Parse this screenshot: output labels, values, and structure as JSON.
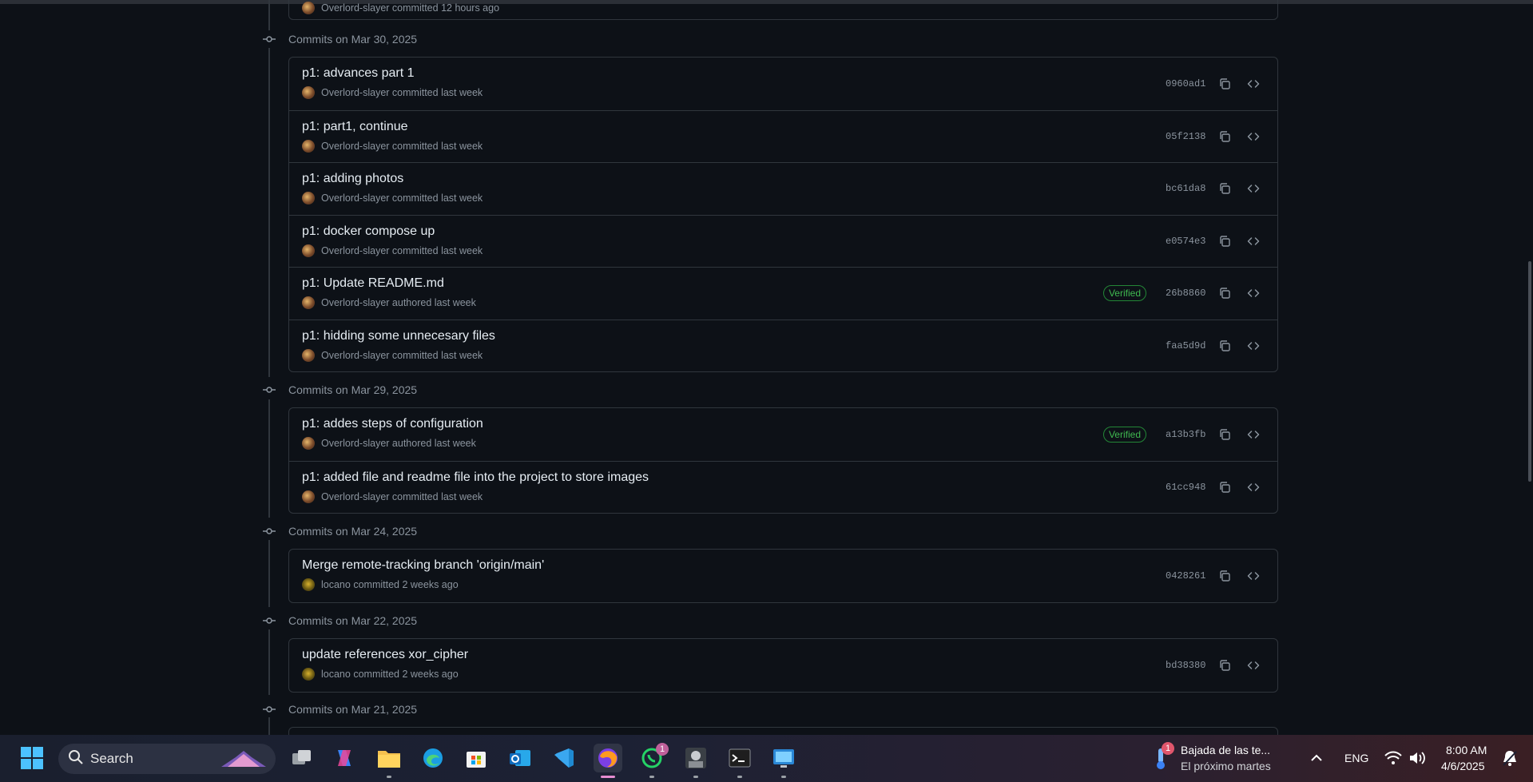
{
  "top_partial": {
    "author": "Overlord-slayer",
    "action": "committed",
    "time": "12 hours ago"
  },
  "groups": [
    {
      "date_label": "Commits on Mar 30, 2025",
      "commits": [
        {
          "title": "p1: advances part 1",
          "author": "Overlord-slayer",
          "action": "committed",
          "time": "last week",
          "verified": "",
          "sha": "0960ad1"
        },
        {
          "title": "p1: part1, continue",
          "author": "Overlord-slayer",
          "action": "committed",
          "time": "last week",
          "verified": "",
          "sha": "05f2138"
        },
        {
          "title": "p1: adding photos",
          "author": "Overlord-slayer",
          "action": "committed",
          "time": "last week",
          "verified": "",
          "sha": "bc61da8"
        },
        {
          "title": "p1: docker compose up",
          "author": "Overlord-slayer",
          "action": "committed",
          "time": "last week",
          "verified": "",
          "sha": "e0574e3"
        },
        {
          "title": "p1: Update README.md",
          "author": "Overlord-slayer",
          "action": "authored",
          "time": "last week",
          "verified": "Verified",
          "sha": "26b8860"
        },
        {
          "title": "p1: hidding some unnecesary files",
          "author": "Overlord-slayer",
          "action": "committed",
          "time": "last week",
          "verified": "",
          "sha": "faa5d9d"
        }
      ]
    },
    {
      "date_label": "Commits on Mar 29, 2025",
      "commits": [
        {
          "title": "p1: addes steps of configuration",
          "author": "Overlord-slayer",
          "action": "authored",
          "time": "last week",
          "verified": "Verified",
          "sha": "a13b3fb"
        },
        {
          "title": "p1: added file and readme file into the project to store images",
          "author": "Overlord-slayer",
          "action": "committed",
          "time": "last week",
          "verified": "",
          "sha": "61cc948"
        }
      ]
    },
    {
      "date_label": "Commits on Mar 24, 2025",
      "commits": [
        {
          "title": "Merge remote-tracking branch 'origin/main'",
          "author": "locano",
          "action": "committed",
          "time": "2 weeks ago",
          "verified": "",
          "sha": "0428261"
        }
      ]
    },
    {
      "date_label": "Commits on Mar 22, 2025",
      "commits": [
        {
          "title": "update references xor_cipher",
          "author": "locano",
          "action": "committed",
          "time": "2 weeks ago",
          "verified": "",
          "sha": "bd38380"
        }
      ]
    },
    {
      "date_label": "Commits on Mar 21, 2025",
      "commits": []
    }
  ],
  "taskbar": {
    "search_label": "Search",
    "whatsapp_badge": "1",
    "weather_badge": "1",
    "weather_title": "Bajada de las te...",
    "weather_sub": "El próximo martes",
    "language": "ENG",
    "time": "8:00 AM",
    "date": "4/6/2025"
  },
  "colors": {
    "background": "#0d1117",
    "border": "#30363d",
    "muted_text": "#8b949e",
    "verified_green": "#3fb950"
  }
}
